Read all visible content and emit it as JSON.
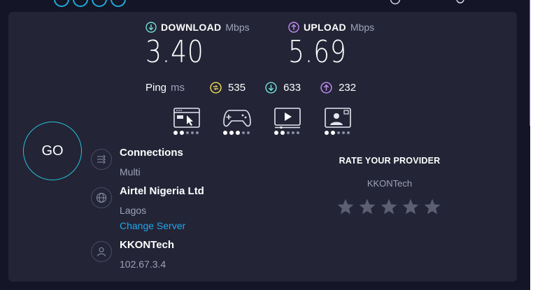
{
  "download": {
    "label": "DOWNLOAD",
    "unit": "Mbps",
    "value": "3.40"
  },
  "upload": {
    "label": "UPLOAD",
    "unit": "Mbps",
    "value": "5.69"
  },
  "ping": {
    "label": "Ping",
    "unit": "ms",
    "idle": "535",
    "download": "633",
    "upload": "232"
  },
  "apps": [
    {
      "icon": "web-browsing-icon",
      "rating": 2
    },
    {
      "icon": "gaming-icon",
      "rating": 3
    },
    {
      "icon": "video-streaming-icon",
      "rating": 2
    },
    {
      "icon": "video-chat-icon",
      "rating": 2
    }
  ],
  "go_label": "GO",
  "connections": {
    "title": "Connections",
    "value": "Multi"
  },
  "server": {
    "name": "Airtel Nigeria Ltd",
    "location": "Lagos",
    "change_label": "Change Server"
  },
  "client": {
    "isp": "KKONTech",
    "ip": "102.67.3.4"
  },
  "rate": {
    "title": "RATE YOUR PROVIDER",
    "isp": "KKONTech",
    "stars": 5,
    "filled": 0
  },
  "colors": {
    "download": "#6ee0d2",
    "upload": "#c38cf5",
    "idle": "#f1d957",
    "go_ring": "#27c3d8",
    "link": "#22a8ec",
    "card": "#232436",
    "background": "#141526"
  }
}
